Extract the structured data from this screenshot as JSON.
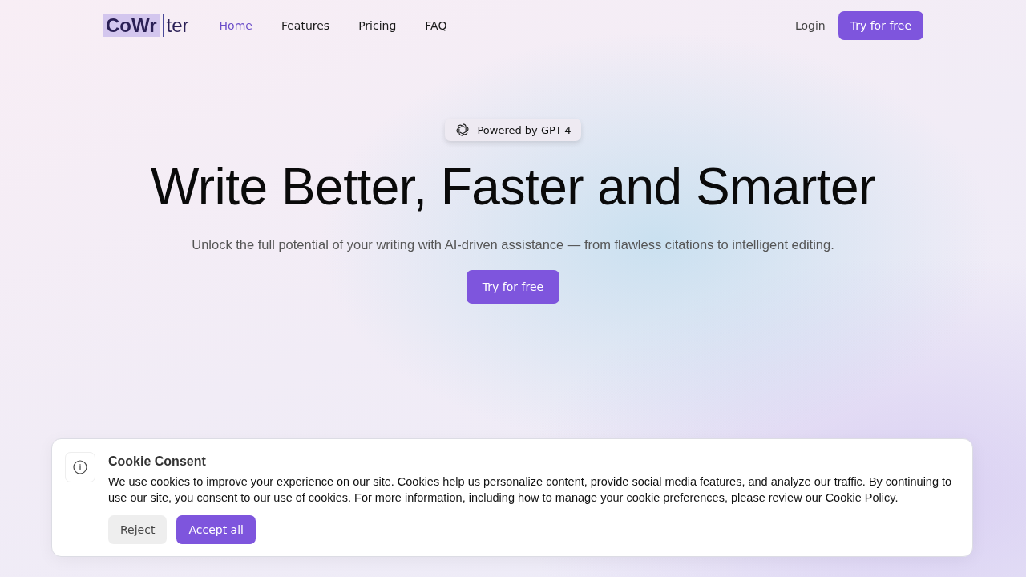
{
  "nav": {
    "logo": {
      "highlighted": "CoWr",
      "rest": "ter"
    },
    "links": [
      {
        "label": "Home",
        "selected": true
      },
      {
        "label": "Features",
        "selected": false
      },
      {
        "label": "Pricing",
        "selected": false
      },
      {
        "label": "FAQ",
        "selected": false
      }
    ],
    "login": "Login",
    "cta": "Try for free"
  },
  "hero": {
    "badge": "Powered by GPT-4",
    "title": "Write Better, Faster and Smarter",
    "subtitle": "Unlock the full potential of your writing with AI-driven assistance — from flawless citations to intelligent editing.",
    "cta": "Try for free"
  },
  "cookie": {
    "title": "Cookie Consent",
    "text": "We use cookies to improve your experience on our site. Cookies help us personalize content, provide social media features, and analyze our traffic. By continuing to use our site, you consent to our use of cookies. For more information, including how to manage your cookie preferences, please review our Cookie Policy.",
    "reject": "Reject",
    "accept": "Accept all"
  }
}
